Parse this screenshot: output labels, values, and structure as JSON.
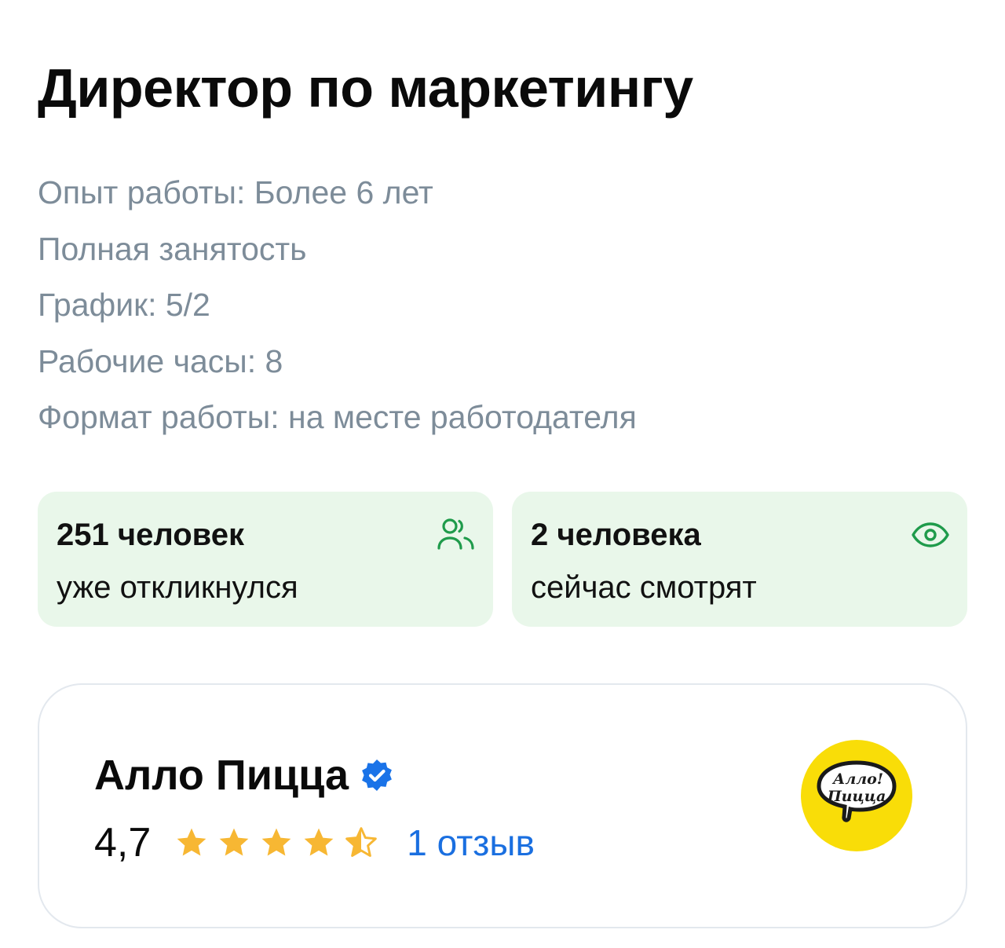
{
  "vacancy": {
    "title": "Директор по маркетингу",
    "details": [
      "Опыт работы: Более 6 лет",
      "Полная занятость",
      "График: 5/2",
      "Рабочие часы: 8",
      "Формат работы: на месте работодателя"
    ]
  },
  "stats": {
    "responded": {
      "count": "251 человек",
      "label": "уже откликнулся",
      "icon": "people-icon"
    },
    "viewing": {
      "count": "2 человека",
      "label": "сейчас смотрят",
      "icon": "eye-icon"
    }
  },
  "company": {
    "name": "Алло Пицца",
    "verified_icon": "verified-badge-icon",
    "rating": "4,7",
    "rating_value": 4.7,
    "stars_max": 5,
    "reviews_link": "1 отзыв",
    "logo_text_line1": "Алло!",
    "logo_text_line2": "Пицца"
  },
  "colors": {
    "stat_bg": "#e9f7ea",
    "stat_icon": "#1f9b4b",
    "muted_text": "#7d8c99",
    "link": "#1a6fe0",
    "star": "#f7b733",
    "verified": "#1a73e8",
    "logo_bg": "#f9dd08"
  }
}
